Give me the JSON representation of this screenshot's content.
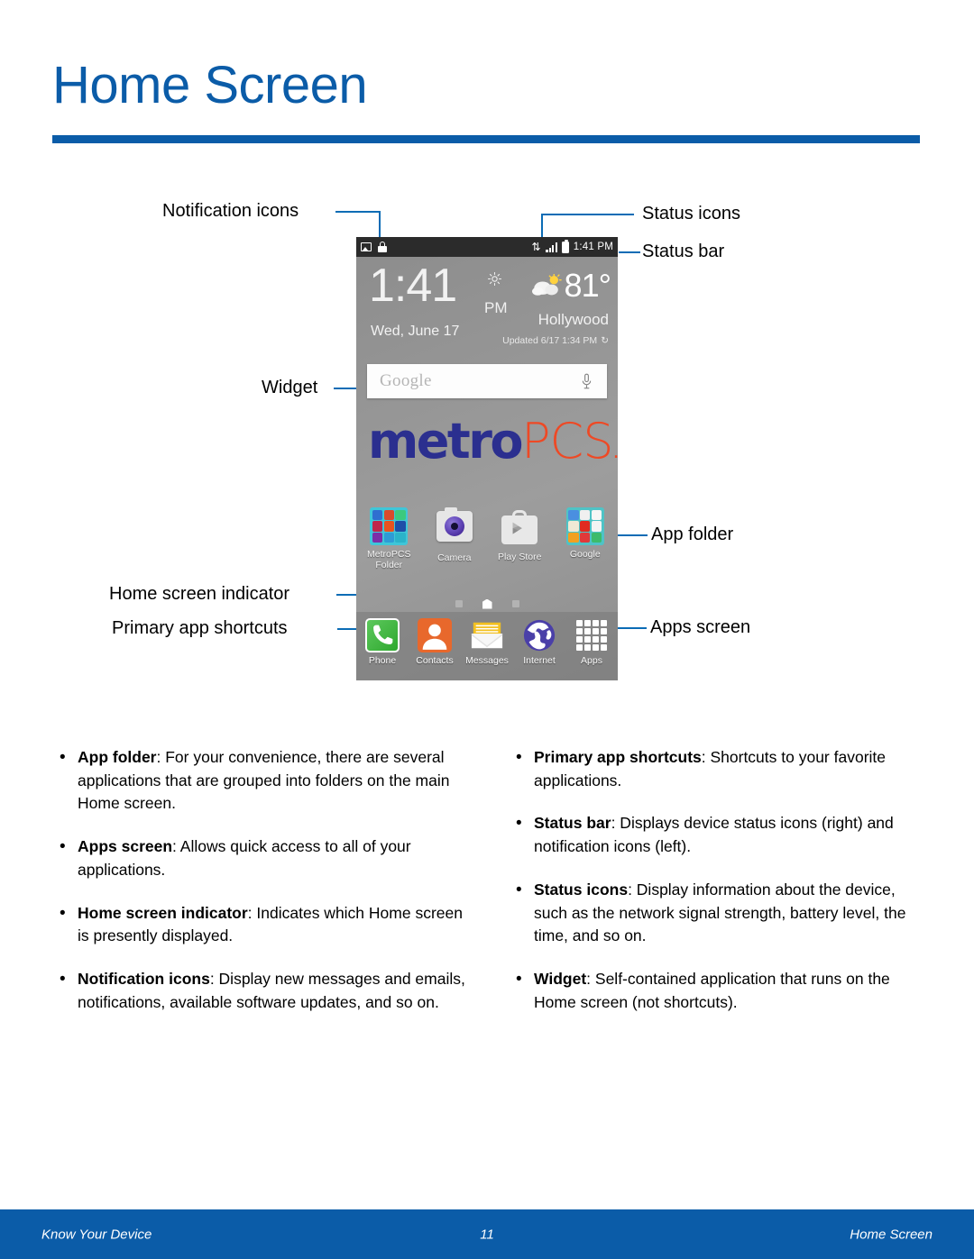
{
  "page": {
    "title": "Home Screen",
    "accent_color": "#0B5CA8"
  },
  "callouts": {
    "notification_icons": "Notification icons",
    "status_icons": "Status icons",
    "status_bar": "Status bar",
    "widget": "Widget",
    "app_folder": "App folder",
    "home_screen_indicator": "Home screen indicator",
    "apps_screen": "Apps screen",
    "primary_app_shortcuts": "Primary app shortcuts"
  },
  "phone": {
    "status_bar": {
      "notification_icons": [
        "image-icon",
        "lock-icon"
      ],
      "status_icons": [
        "data-transfer-icon",
        "signal-bars-icon",
        "battery-icon"
      ],
      "time": "1:41 PM"
    },
    "clock_widget": {
      "time": "1:41",
      "meridiem": "PM",
      "date": "Wed, June 17",
      "temperature": "81°",
      "city": "Hollywood",
      "updated": "Updated 6/17 1:34 PM"
    },
    "search_widget": {
      "placeholder": "Google",
      "mic_icon": "microphone-icon"
    },
    "wallpaper_logo": {
      "part1": "metro",
      "part2": "PCS",
      "part1_color": "#2B2F8F",
      "part2_color": "#EE4925"
    },
    "app_row": [
      {
        "label": "MetroPCS\nFolder",
        "label_line1": "MetroPCS",
        "label_line2": "Folder",
        "icon": "metropcs-folder-icon"
      },
      {
        "label": "Camera",
        "icon": "camera-icon"
      },
      {
        "label": "Play Store",
        "icon": "play-store-icon"
      },
      {
        "label": "Google",
        "icon": "google-folder-icon"
      }
    ],
    "home_screen_indicator": {
      "pages": 3,
      "active_index": 1
    },
    "dock": [
      {
        "label": "Phone",
        "icon": "phone-icon"
      },
      {
        "label": "Contacts",
        "icon": "contacts-icon"
      },
      {
        "label": "Messages",
        "icon": "messages-icon"
      },
      {
        "label": "Internet",
        "icon": "internet-icon"
      },
      {
        "label": "Apps",
        "icon": "apps-grid-icon"
      }
    ]
  },
  "body": {
    "left_column": [
      {
        "term": "App folder",
        "text": ": For your convenience, there are several applications that are grouped into folders on the main Home screen."
      },
      {
        "term": "Apps screen",
        "text": ": Allows quick access to all of your applications."
      },
      {
        "term": "Home screen indicator",
        "text": ": Indicates which Home screen is presently displayed."
      },
      {
        "term": "Notification icons",
        "text": ": Display new messages and emails, notifications, available software updates, and so on."
      }
    ],
    "right_column": [
      {
        "term": "Primary app shortcuts",
        "text": ": Shortcuts to your favorite applications."
      },
      {
        "term": "Status bar",
        "text": ": Displays device status icons (right) and notification icons (left)."
      },
      {
        "term": "Status icons",
        "text": ": Display information about the device, such as the network signal strength, battery level, the time, and so on."
      },
      {
        "term": "Widget",
        "text": ": Self-contained application that runs on the Home screen (not shortcuts)."
      }
    ]
  },
  "footer": {
    "left": "Know Your Device",
    "page_number": "11",
    "right": "Home Screen"
  }
}
